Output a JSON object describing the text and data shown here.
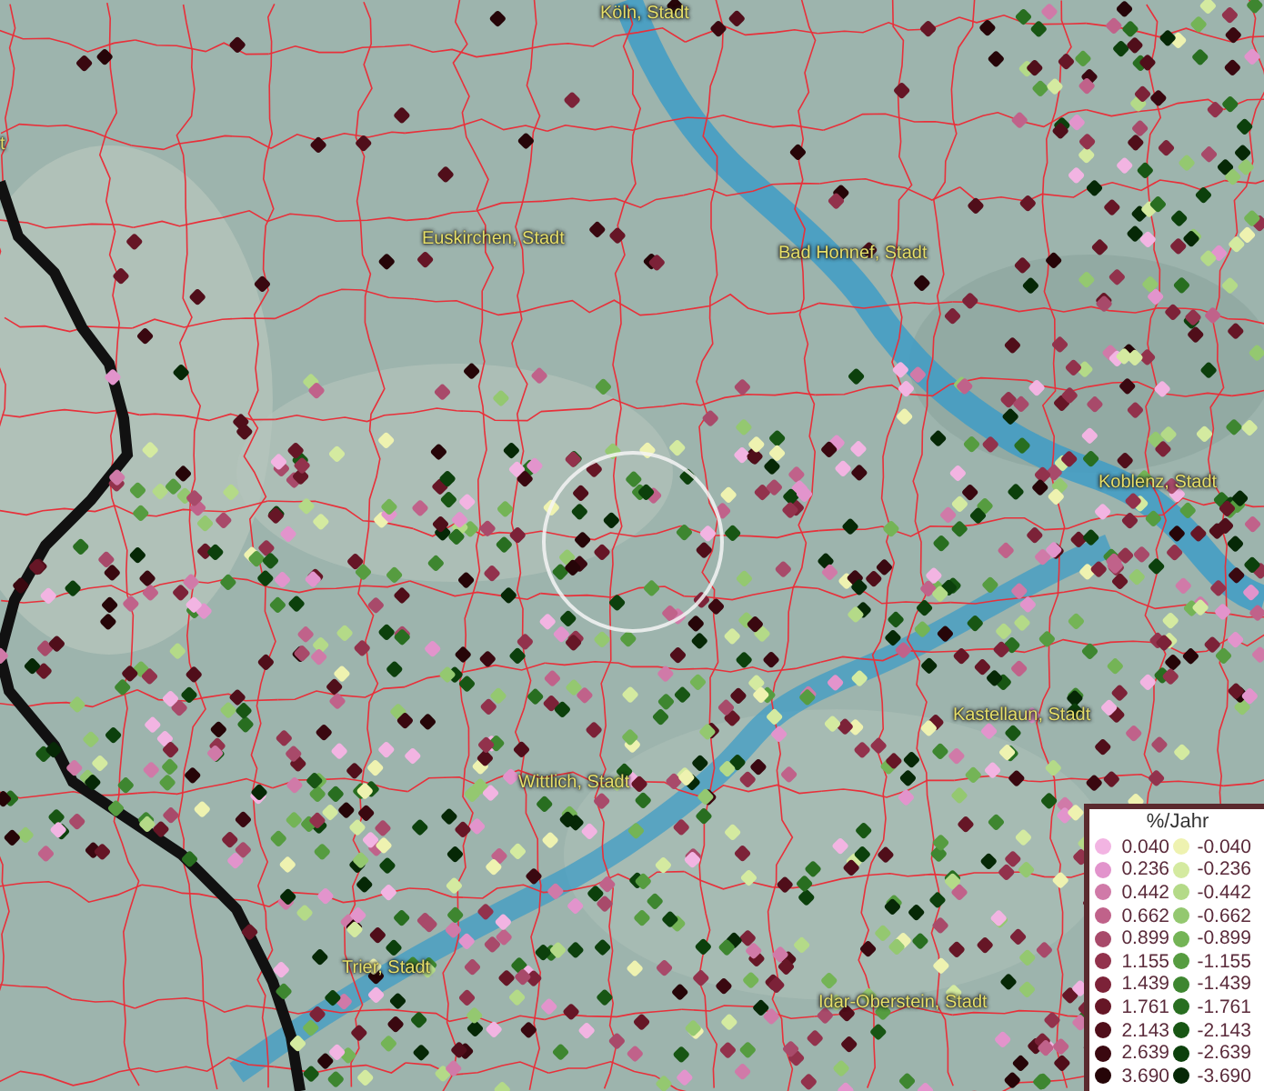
{
  "map": {
    "place_labels": [
      {
        "text": "Köln, Stadt"
      },
      {
        "text": "t"
      },
      {
        "text": "Euskirchen, Stadt"
      },
      {
        "text": "Bad Honnef, Stadt"
      },
      {
        "text": "Koblenz, Stadt"
      },
      {
        "text": "Kastellaun, Stadt"
      },
      {
        "text": "Wittlich, Stadt"
      },
      {
        "text": "Trier, Stadt"
      },
      {
        "text": "Idar-Oberstein, Stadt"
      }
    ]
  },
  "legend": {
    "title": "%/Jahr",
    "rows": [
      {
        "positive": {
          "value": "0.040",
          "color": "#f2b4e2"
        },
        "negative": {
          "value": "-0.040",
          "color": "#eef2b0"
        }
      },
      {
        "positive": {
          "value": "0.236",
          "color": "#e294cc"
        },
        "negative": {
          "value": "-0.236",
          "color": "#d4eaa0"
        }
      },
      {
        "positive": {
          "value": "0.442",
          "color": "#d07aa8"
        },
        "negative": {
          "value": "-0.442",
          "color": "#b4da88"
        }
      },
      {
        "positive": {
          "value": "0.662",
          "color": "#c0628a"
        },
        "negative": {
          "value": "-0.662",
          "color": "#94c870"
        }
      },
      {
        "positive": {
          "value": "0.899",
          "color": "#a84a6a"
        },
        "negative": {
          "value": "-0.899",
          "color": "#74b456"
        }
      },
      {
        "positive": {
          "value": "1.155",
          "color": "#92324c"
        },
        "negative": {
          "value": "-1.155",
          "color": "#569c40"
        }
      },
      {
        "positive": {
          "value": "1.439",
          "color": "#7c2238"
        },
        "negative": {
          "value": "-1.439",
          "color": "#3e8630"
        }
      },
      {
        "positive": {
          "value": "1.761",
          "color": "#661626"
        },
        "negative": {
          "value": "-1.761",
          "color": "#286e20"
        }
      },
      {
        "positive": {
          "value": "2.143",
          "color": "#500e1a"
        },
        "negative": {
          "value": "-2.143",
          "color": "#185614"
        }
      },
      {
        "positive": {
          "value": "2.639",
          "color": "#3a0810"
        },
        "negative": {
          "value": "-2.639",
          "color": "#0c400c"
        }
      },
      {
        "positive": {
          "value": "3.690",
          "color": "#260508"
        },
        "negative": {
          "value": "-3.690",
          "color": "#062806"
        }
      }
    ]
  }
}
